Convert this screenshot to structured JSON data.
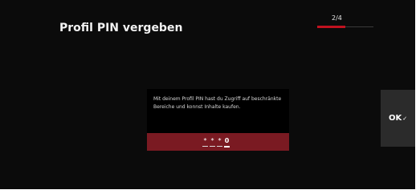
{
  "header": {
    "title": "Profil PIN vergeben",
    "step": "2/4",
    "step_progress": 0.5
  },
  "card": {
    "message": "Mit deinem Profil PIN hast du Zugriff auf beschränkte Bereiche und konnst Inhalte kaufen.",
    "pin_digits": [
      "*",
      "*",
      "*",
      "0"
    ]
  },
  "ok_button": {
    "label": "OK",
    "icon": "✓"
  },
  "colors": {
    "background": "#0b0b0b",
    "accent": "#c1121f",
    "pin_bar": "#7a1a22",
    "ok_button": "#2b2b2b"
  }
}
